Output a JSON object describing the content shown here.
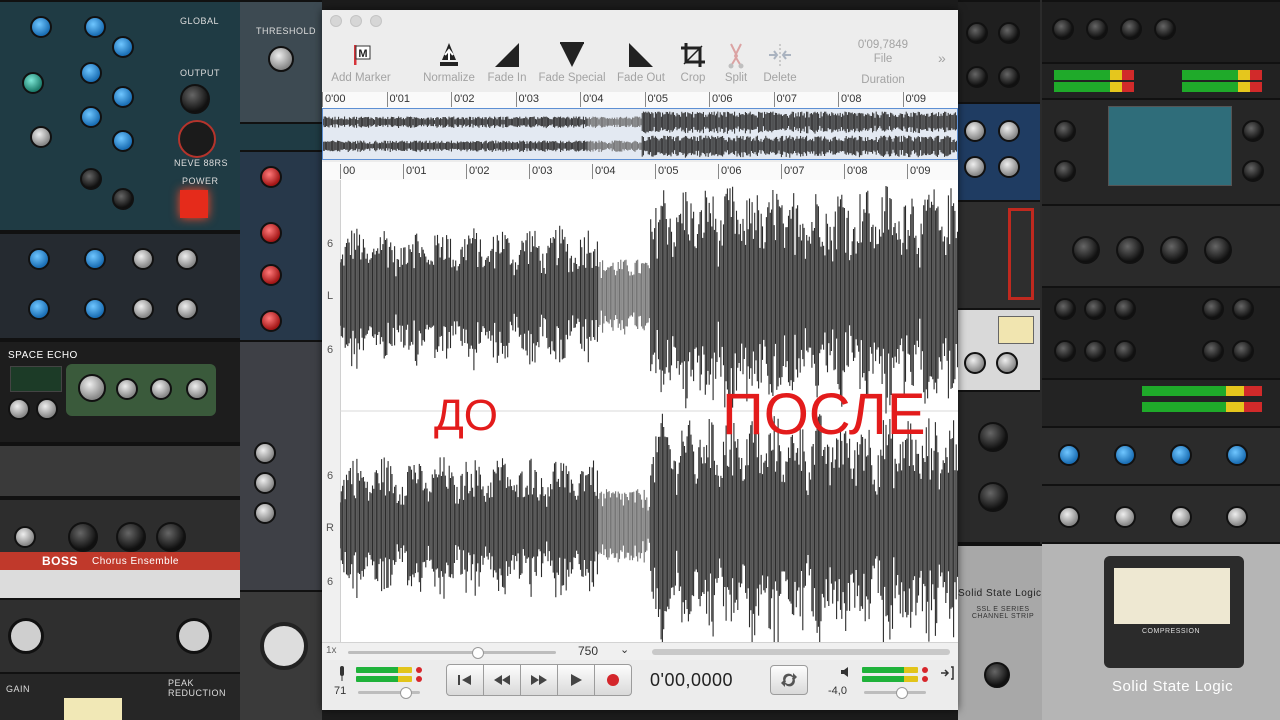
{
  "toolbar": {
    "add_marker": "Add Marker",
    "normalize": "Normalize",
    "fade_in": "Fade In",
    "fade_special": "Fade Special",
    "fade_out": "Fade Out",
    "crop": "Crop",
    "split": "Split",
    "delete": "Delete",
    "duration_value": "0'09,7849",
    "duration_file": "File",
    "duration_label": "Duration",
    "marker_glyph": "M",
    "more": "»"
  },
  "ruler": {
    "overview_ticks": [
      "0'00",
      "0'01",
      "0'02",
      "0'03",
      "0'04",
      "0'05",
      "0'06",
      "0'07",
      "0'08",
      "0'09"
    ],
    "detail_ticks": [
      "00",
      "0'01",
      "0'02",
      "0'03",
      "0'04",
      "0'05",
      "0'06",
      "0'07",
      "0'08",
      "0'09"
    ]
  },
  "channels": {
    "left_label": "L",
    "right_label": "R",
    "scale_mark": "6"
  },
  "overlay": {
    "before": "ДО",
    "after": "ПОСЛЕ",
    "color": "#e31b1b"
  },
  "zoom": {
    "prefix": "1x",
    "value": "750",
    "arrow": "⌄",
    "slider_fraction": 0.62
  },
  "transport": {
    "input_level": "71",
    "timecode": "0'00,0000",
    "output_level": "-4,0",
    "input_slider_fraction": 0.75,
    "output_slider_fraction": 0.6
  },
  "hardware_labels": {
    "global": "GLOBAL",
    "output": "OUTPUT",
    "neve": "NEVE 88RS",
    "power": "POWER",
    "threshold": "THRESHOLD",
    "space_echo": "SPACE ECHO",
    "boss": "BOSS",
    "chorus_ensemble": "Chorus Ensemble",
    "gain": "GAIN",
    "peak_reduction": "PEAK REDUCTION",
    "ssl": "Solid State Logic",
    "ssl_strip": "SSL E SERIES CHANNEL STRIP",
    "ssl_big": "Solid State Logic",
    "compression": "COMPRESSION"
  },
  "colors": {
    "waveform": "#2b2b2b",
    "waveform_quiet": "#707070",
    "selection": "#5d8fd3"
  }
}
